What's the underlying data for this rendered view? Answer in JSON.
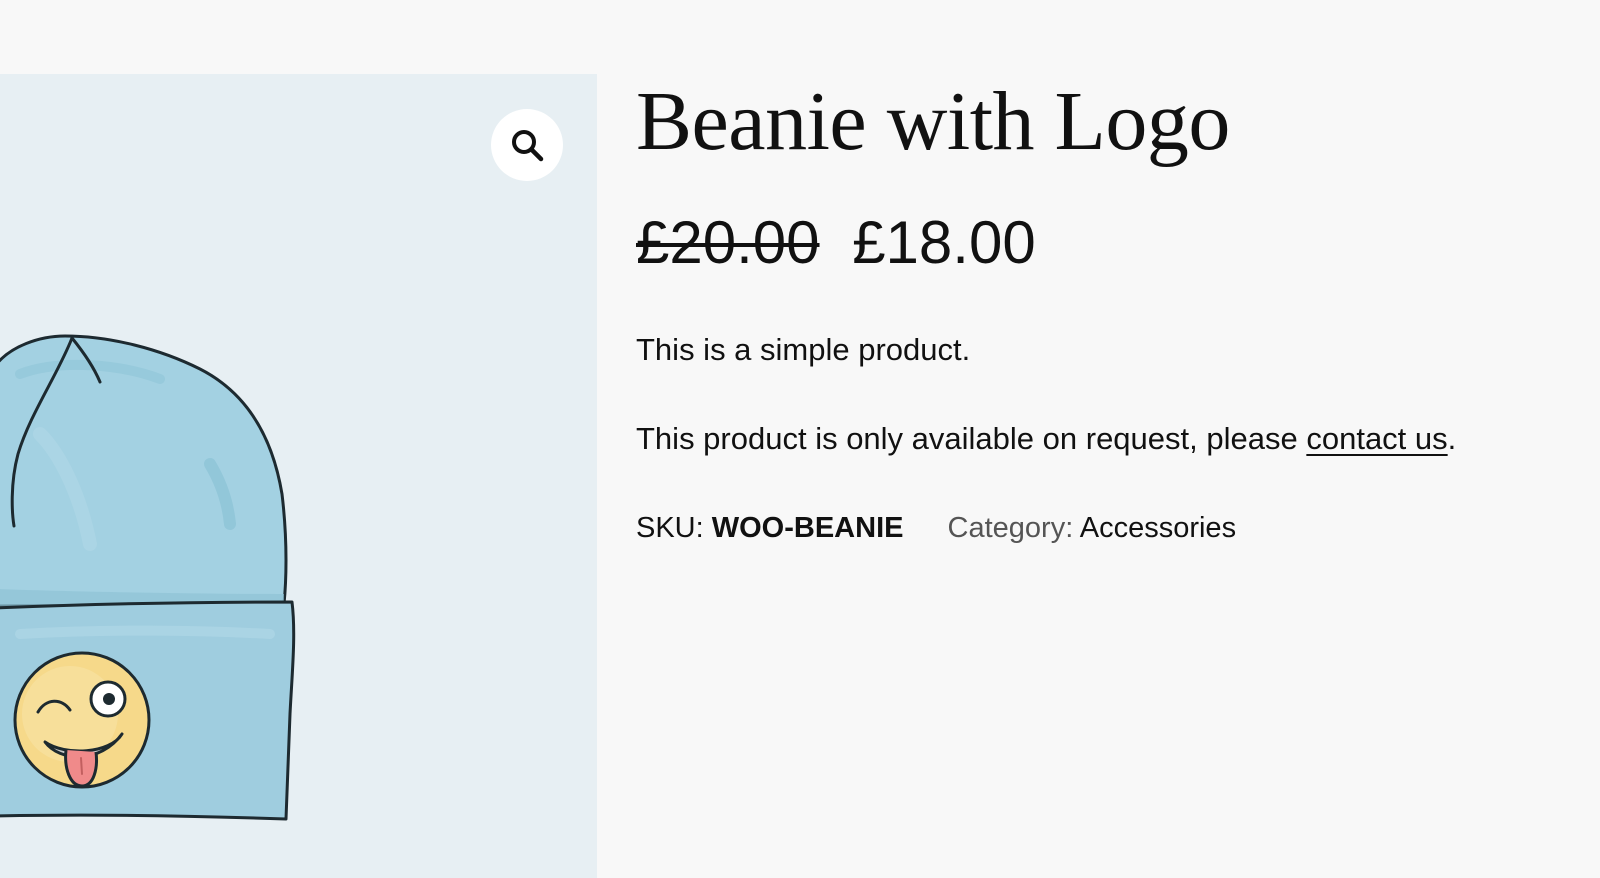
{
  "product": {
    "title": "Beanie with Logo",
    "regular_price": "£20.00",
    "sale_price": "£18.00",
    "description": "This is a simple product.",
    "availability_text": "This product is only available on request, please ",
    "contact_link_text": "contact us",
    "availability_end": ".",
    "sku_label": "SKU:",
    "sku_value": "WOO-BEANIE",
    "category_label": "Category:",
    "category_value": "Accessories"
  },
  "gallery": {
    "zoom_icon": "search-icon",
    "image_subject": "beanie-illustration"
  },
  "colors": {
    "page_background": "#f8f8f8",
    "gallery_background": "#e7eff3",
    "beanie_blue": "#9fcfdf",
    "emoji_yellow": "#f6d98a"
  }
}
